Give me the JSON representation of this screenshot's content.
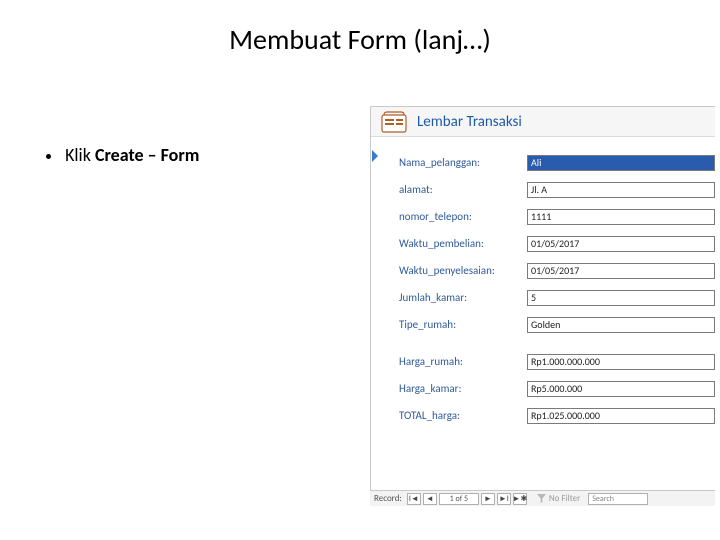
{
  "slide": {
    "title": "Membuat Form (lanj…)",
    "bullet_prefix": "Klik ",
    "bullet_bold": "Create – Form"
  },
  "form": {
    "headerTitle": "Lembar Transaksi",
    "fields": [
      {
        "label": "Nama_pelanggan:",
        "value": "Ali",
        "selected": true
      },
      {
        "label": "alamat:",
        "value": "Jl. A"
      },
      {
        "label": "nomor_telepon:",
        "value": "1111"
      },
      {
        "label": "Waktu_pembelian:",
        "value": "01/05/2017"
      },
      {
        "label": "Waktu_penyelesaian:",
        "value": "01/05/2017"
      },
      {
        "label": "Jumlah_kamar:",
        "value": "5"
      },
      {
        "label": "Tipe_rumah:",
        "value": "Golden"
      },
      {
        "label": "Harga_rumah:",
        "value": "Rp1.000.000.000",
        "gap": true
      },
      {
        "label": "Harga_kamar:",
        "value": "Rp5.000.000"
      },
      {
        "label": "TOTAL_harga:",
        "value": "Rp1.025.000.000"
      }
    ]
  },
  "recordbar": {
    "label": "Record:",
    "first": "I◄",
    "prev": "◄",
    "position": "1 of 5",
    "next": "►",
    "last": "►I",
    "new": "►✱",
    "filter": "No Filter",
    "search": "Search"
  }
}
